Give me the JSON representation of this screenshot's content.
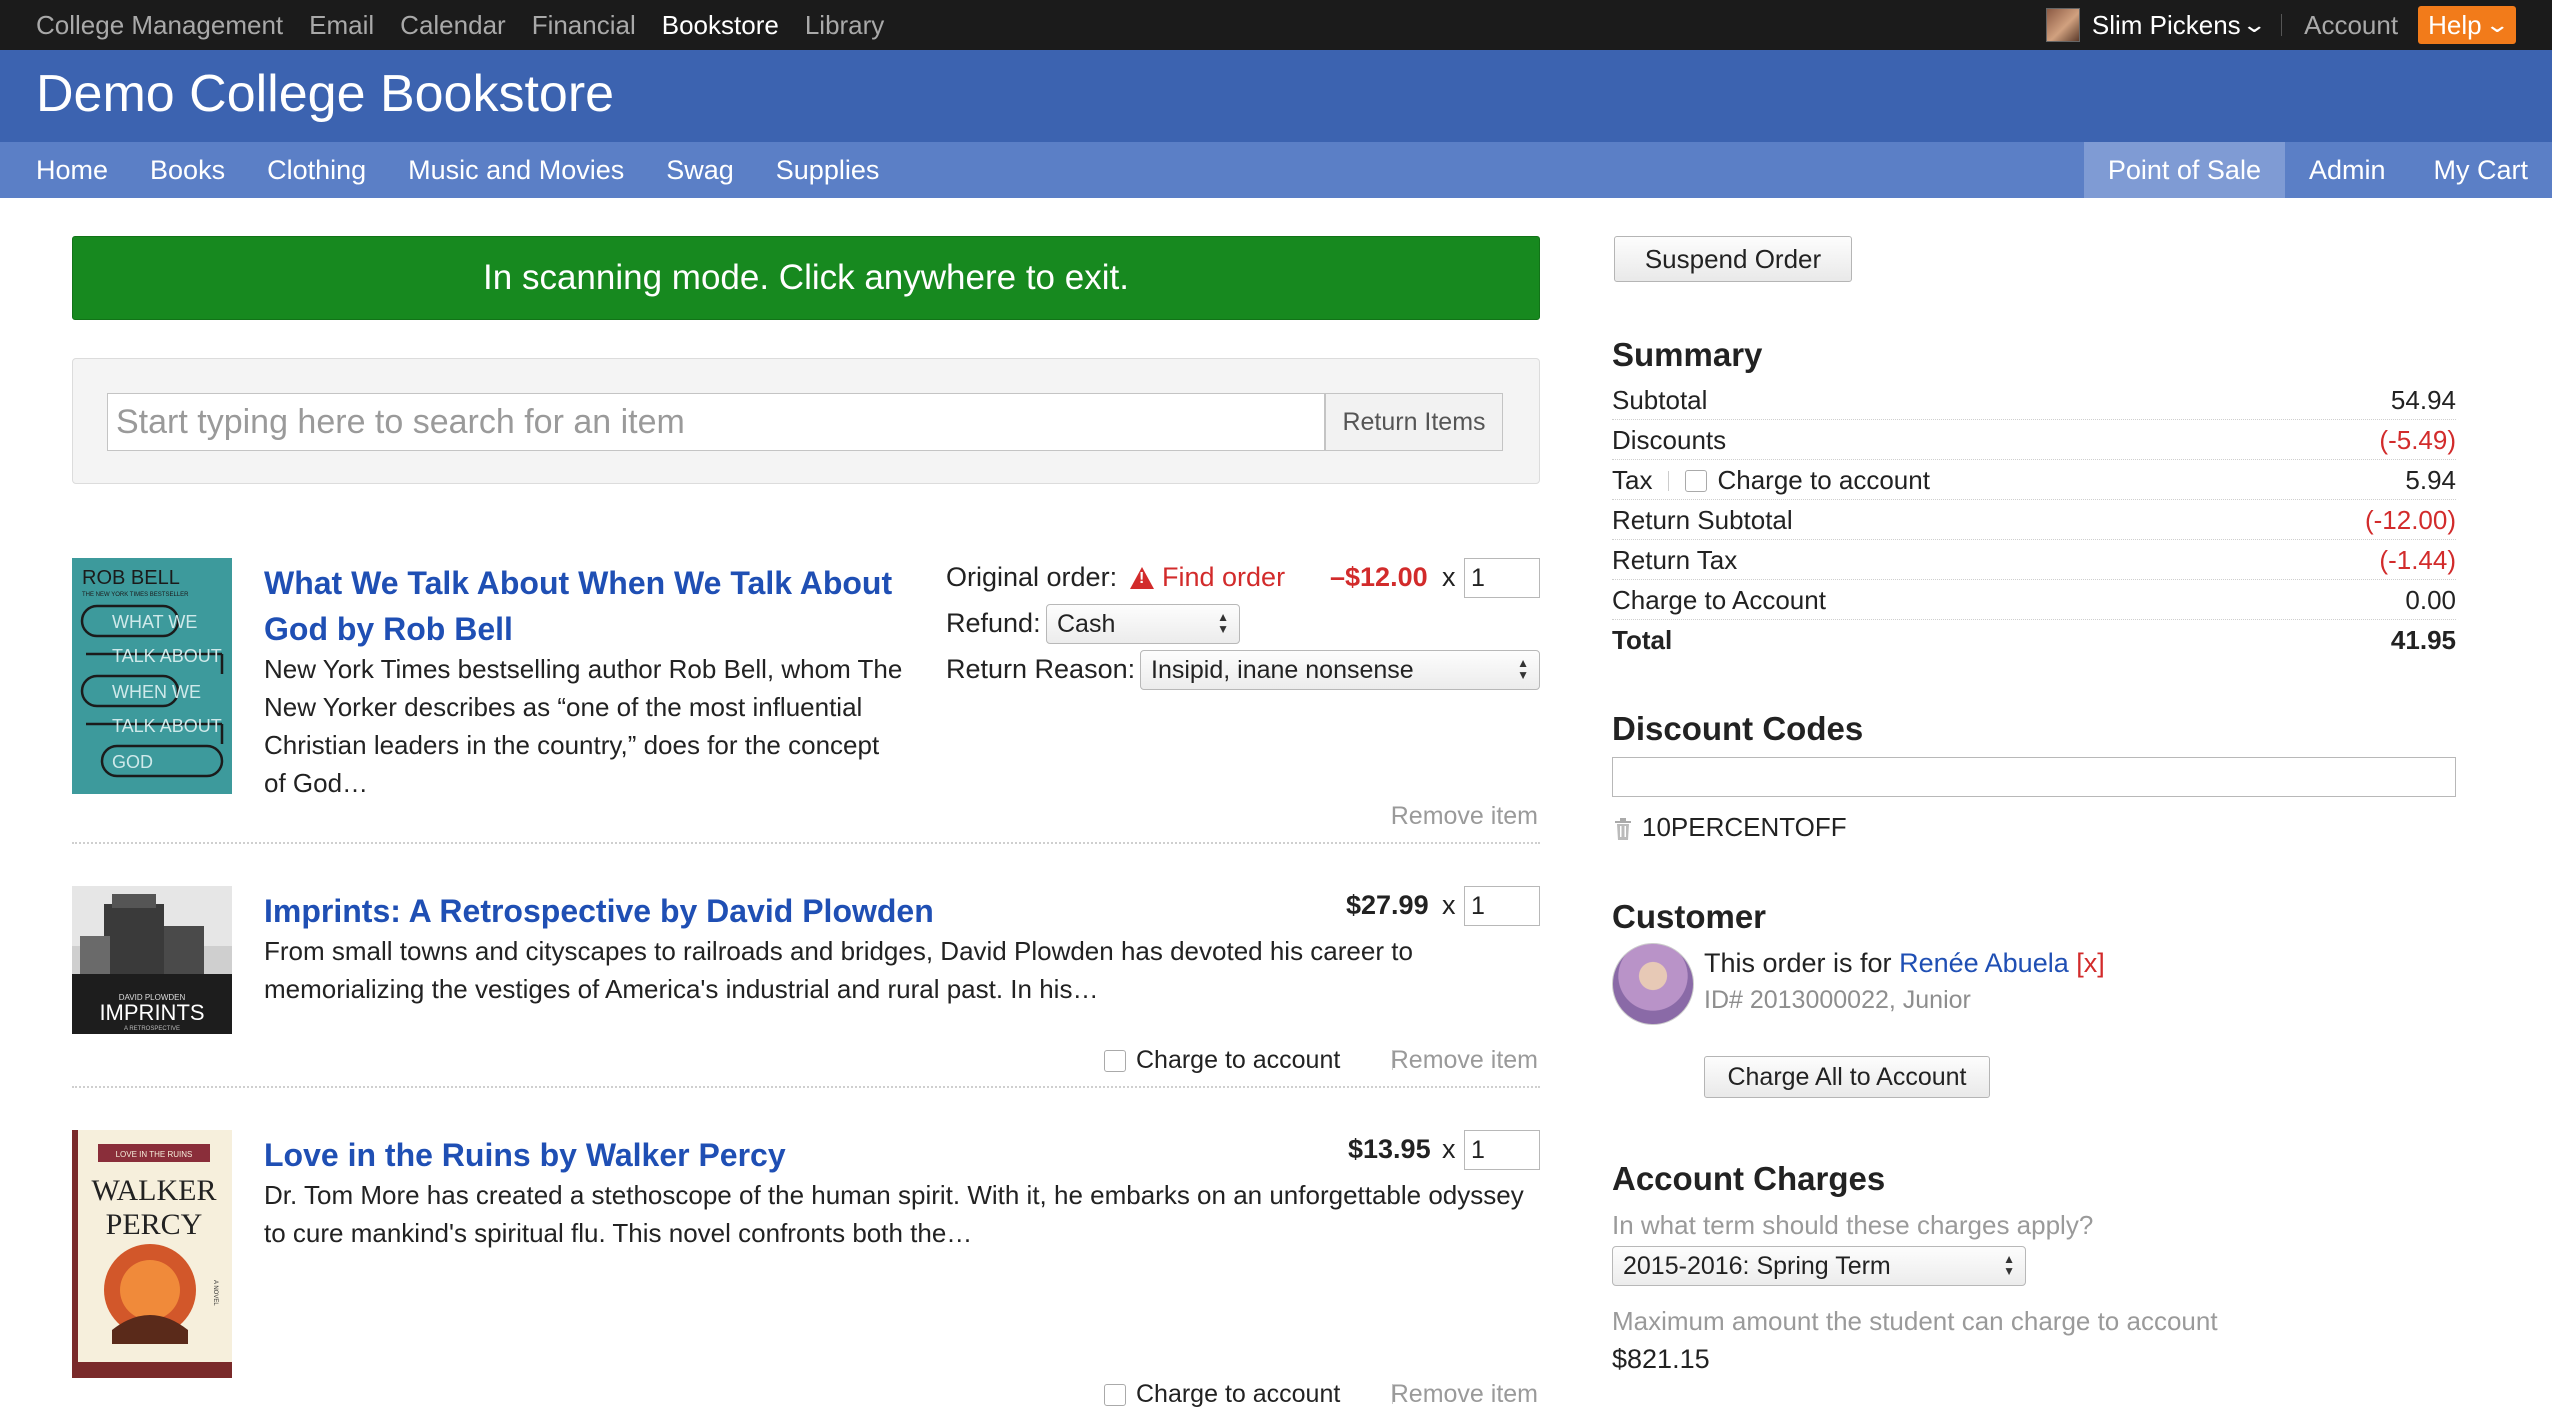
{
  "topbar": {
    "apps": [
      "College Management",
      "Email",
      "Calendar",
      "Financial",
      "Bookstore",
      "Library"
    ],
    "active_app": "Bookstore",
    "user_name": "Slim Pickens",
    "account_label": "Account",
    "help_label": "Help"
  },
  "site": {
    "title": "Demo College Bookstore"
  },
  "nav": {
    "left": [
      "Home",
      "Books",
      "Clothing",
      "Music and Movies",
      "Swag",
      "Supplies"
    ],
    "right": [
      "Point of Sale",
      "Admin",
      "My Cart"
    ],
    "active": "Point of Sale"
  },
  "banner": {
    "text": "In scanning mode. Click anywhere to exit."
  },
  "search": {
    "placeholder": "Start typing here to search for an item",
    "return_label": "Return Items"
  },
  "items": [
    {
      "title": "What We Talk About When We Talk About God by Rob Bell",
      "description": "New York Times bestselling author Rob Bell, whom The New Yorker describes as “one of the most influential Christian leaders in the country,” does for the concept of God…",
      "price": "–$12.00",
      "qty": "1",
      "original_order_label": "Original order:",
      "find_order_label": "Find order",
      "refund_label": "Refund:",
      "refund_value": "Cash",
      "reason_label": "Return Reason:",
      "reason_value": "Insipid, inane nonsense",
      "remove_label": "Remove item",
      "cover": {
        "author": "ROB BELL",
        "subtitle": "THE NEW YORK TIMES BESTSELLER",
        "words": [
          "WHAT WE",
          "TALK ABOUT",
          "WHEN WE",
          "TALK ABOUT",
          "GOD"
        ]
      }
    },
    {
      "title": "Imprints: A Retrospective by David Plowden",
      "description": "From small towns and cityscapes to railroads and bridges, David Plowden has devoted his career to memorializing the vestiges of America's industrial and rural past. In his…",
      "price": "$27.99",
      "qty": "1",
      "charge_label": "Charge to account",
      "remove_label": "Remove item",
      "cover": {
        "author": "DAVID PLOWDEN",
        "title": "IMPRINTS",
        "subtitle": "A RETROSPECTIVE"
      }
    },
    {
      "title": "Love in the Ruins by Walker Percy",
      "description": "Dr. Tom More has created a stethoscope of the human spirit. With it, he embarks on an unforgettable odyssey to cure mankind's spiritual flu. This novel confronts both the…",
      "price": "$13.95",
      "qty": "1",
      "charge_label": "Charge to account",
      "remove_label": "Remove item",
      "cover": {
        "title": "LOVE IN THE RUINS",
        "author_first": "WALKER",
        "author_last": "PERCY",
        "tag": "A NOVEL"
      }
    }
  ],
  "order": {
    "suspend_label": "Suspend Order",
    "summary_title": "Summary",
    "summary": [
      {
        "label": "Subtotal",
        "value": "54.94"
      },
      {
        "label": "Discounts",
        "value": "(-5.49)"
      },
      {
        "label": "Tax",
        "value": "5.94",
        "checkbox_label": "Charge to account"
      },
      {
        "label": "Return Subtotal",
        "value": "(-12.00)"
      },
      {
        "label": "Return Tax",
        "value": "(-1.44)"
      },
      {
        "label": "Charge to Account",
        "value": "0.00"
      },
      {
        "label": "Total",
        "value": "41.95"
      }
    ],
    "discount_title": "Discount Codes",
    "discount_code": "10PERCENTOFF",
    "customer_title": "Customer",
    "customer_prefix": "This order is for",
    "customer_name": "Renée Abuela",
    "customer_remove": "[x]",
    "customer_id": "ID# 2013000022, Junior",
    "charge_all_label": "Charge All to Account",
    "account_title": "Account Charges",
    "term_question": "In what term should these charges apply?",
    "term_value": "2015-2016: Spring Term",
    "max_label": "Maximum amount the student can charge to account",
    "max_value": "$821.15"
  },
  "colors": {
    "topbar": "#1b1b1b",
    "titlebar": "#3c63b0",
    "navbar": "#5b7fc6",
    "banner": "#17891f",
    "link": "#1f4fb4",
    "negative": "#d22b2b",
    "help": "#f27b1a"
  }
}
